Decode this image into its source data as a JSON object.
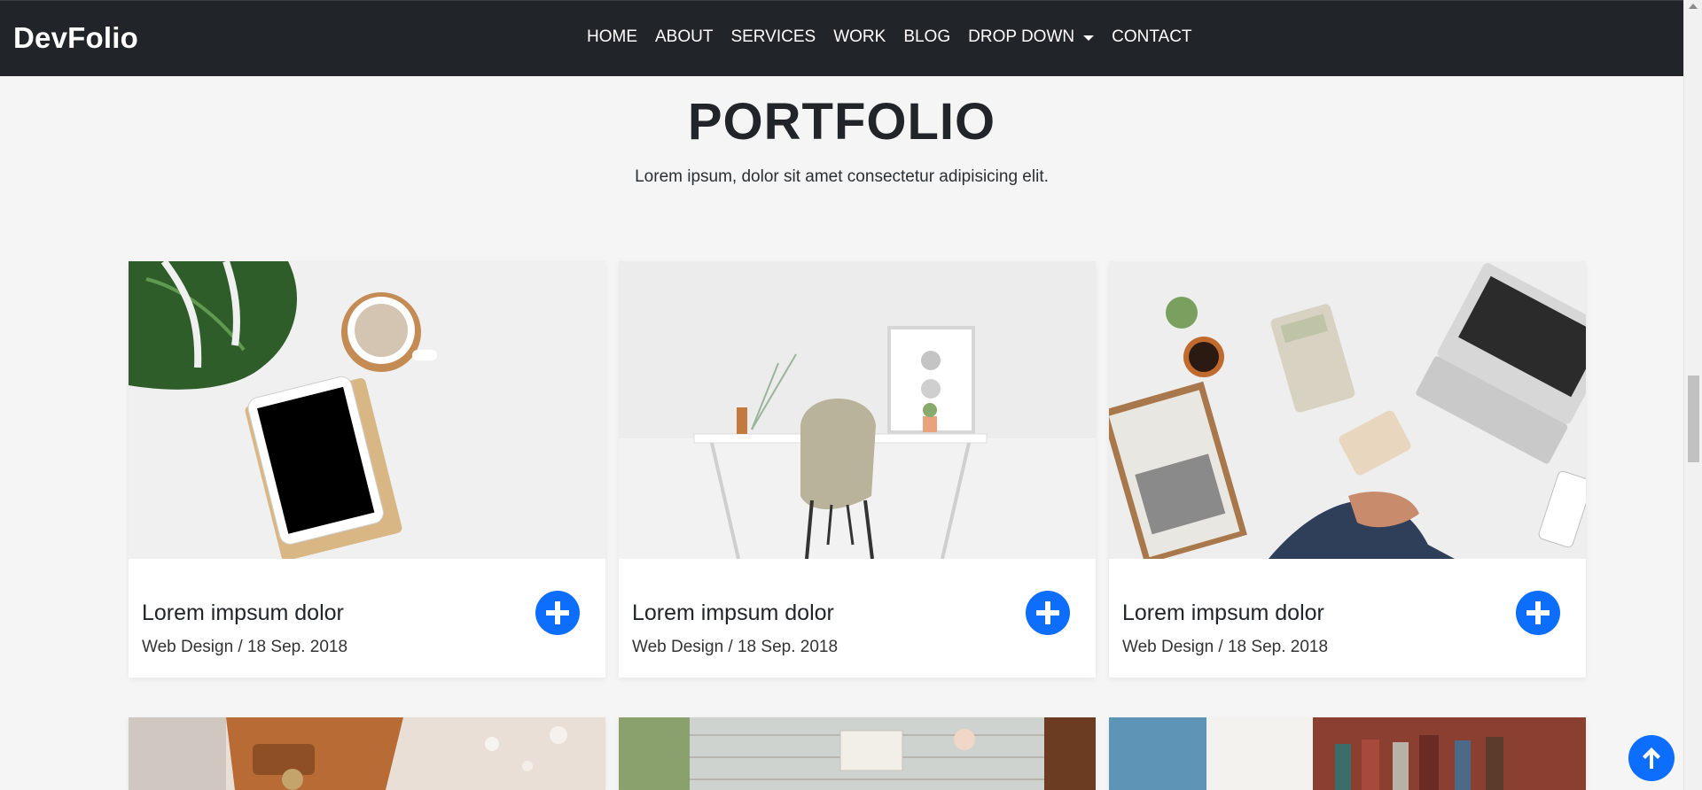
{
  "navbar": {
    "brand": "DevFolio",
    "items": [
      {
        "label": "HOME"
      },
      {
        "label": "ABOUT"
      },
      {
        "label": "SERVICES"
      },
      {
        "label": "WORK"
      },
      {
        "label": "BLOG"
      },
      {
        "label": "DROP DOWN"
      },
      {
        "label": "CONTACT"
      }
    ]
  },
  "section": {
    "title": "PORTFOLIO",
    "subtitle": "Lorem ipsum, dolor sit amet consectetur adipisicing elit."
  },
  "cards": [
    {
      "title": "Lorem impsum dolor",
      "meta": "Web Design / 18 Sep. 2018",
      "icon": "plus-icon"
    },
    {
      "title": "Lorem impsum dolor",
      "meta": "Web Design / 18 Sep. 2018",
      "icon": "plus-icon"
    },
    {
      "title": "Lorem impsum dolor",
      "meta": "Web Design / 18 Sep. 2018",
      "icon": "plus-icon"
    }
  ],
  "colors": {
    "navbar_bg": "#212529",
    "page_bg": "#f5f5f5",
    "accent": "#0d6efd"
  },
  "icons": {
    "dropdown": "caret-down-icon",
    "back_to_top": "arrow-up-icon"
  }
}
